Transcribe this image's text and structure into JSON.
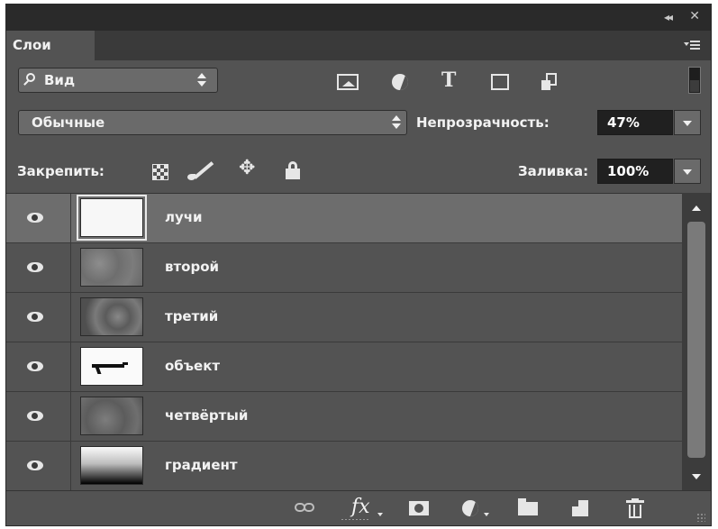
{
  "panel": {
    "tab_label": "Слои",
    "collapse_glyph": "◂◂",
    "close_glyph": "✕"
  },
  "filter": {
    "label": "Вид",
    "icons": [
      "image-filter-icon",
      "adjustment-filter-icon",
      "type-filter-icon",
      "shape-filter-icon",
      "smart-object-filter-icon"
    ],
    "type_glyph": "T"
  },
  "blend": {
    "mode": "Обычные",
    "opacity_label": "Непрозрачность:",
    "opacity_value": "47%"
  },
  "lock": {
    "label": "Закрепить:",
    "move_glyph": "✥",
    "fill_label": "Заливка:",
    "fill_value": "100%"
  },
  "layers": [
    {
      "name": "лучи",
      "selected": true,
      "visible": true,
      "thumb": "white-transparent"
    },
    {
      "name": "второй",
      "selected": false,
      "visible": true,
      "thumb": "texture"
    },
    {
      "name": "третий",
      "selected": false,
      "visible": true,
      "thumb": "texture"
    },
    {
      "name": "объект",
      "selected": false,
      "visible": true,
      "thumb": "object"
    },
    {
      "name": "четвёртый",
      "selected": false,
      "visible": true,
      "thumb": "texture"
    },
    {
      "name": "градиент",
      "selected": false,
      "visible": true,
      "thumb": "gradient"
    }
  ],
  "bottom": {
    "fx_glyph": "fx",
    "icons": [
      "link-layers-icon",
      "layer-style-icon",
      "layer-mask-icon",
      "new-adjustment-icon",
      "new-group-icon",
      "new-layer-icon",
      "delete-layer-icon"
    ]
  },
  "colors": {
    "panel_bg": "#535353",
    "title_bg": "#2a2a2a",
    "selected_row": "#6d6d6d",
    "value_box": "#202020"
  }
}
